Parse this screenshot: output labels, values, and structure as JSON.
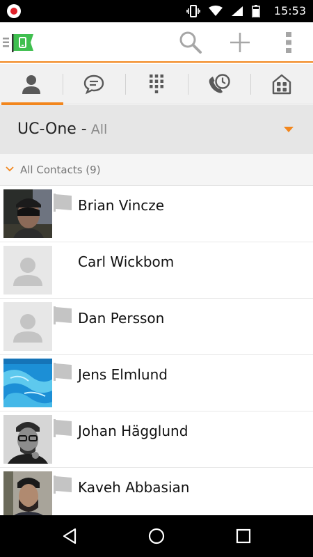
{
  "status_bar": {
    "time": "15:53",
    "icons": [
      "record-icon",
      "vibrate-icon",
      "wifi-icon",
      "signal-icon",
      "battery-icon"
    ]
  },
  "app_bar": {
    "logo": "uc-one-flag-logo",
    "actions": [
      "search-icon",
      "add-icon",
      "overflow-menu-icon"
    ]
  },
  "tabs": [
    {
      "icon": "contacts-icon",
      "active": true
    },
    {
      "icon": "chat-icon",
      "active": false
    },
    {
      "icon": "dialpad-icon",
      "active": false
    },
    {
      "icon": "history-icon",
      "active": false
    },
    {
      "icon": "apps-icon",
      "active": false
    }
  ],
  "source": {
    "name": "UC-One -",
    "filter": "All"
  },
  "group": {
    "label": "All Contacts (9)"
  },
  "contacts": [
    {
      "name": "Brian Vincze",
      "avatar": "photo",
      "flag": true
    },
    {
      "name": "Carl Wickbom",
      "avatar": "placeholder",
      "flag": false
    },
    {
      "name": "Dan Persson",
      "avatar": "placeholder",
      "flag": true
    },
    {
      "name": "Jens Elmlund",
      "avatar": "photo",
      "flag": true
    },
    {
      "name": "Johan Hägglund",
      "avatar": "photo",
      "flag": true
    },
    {
      "name": "Kaveh Abbasian",
      "avatar": "photo",
      "flag": true
    }
  ],
  "nav_bar": {
    "buttons": [
      "back-icon",
      "home-icon",
      "recents-icon"
    ]
  },
  "colors": {
    "accent": "#f2861d",
    "logo_green": "#3fbf4f",
    "icon_gray": "#595959"
  }
}
